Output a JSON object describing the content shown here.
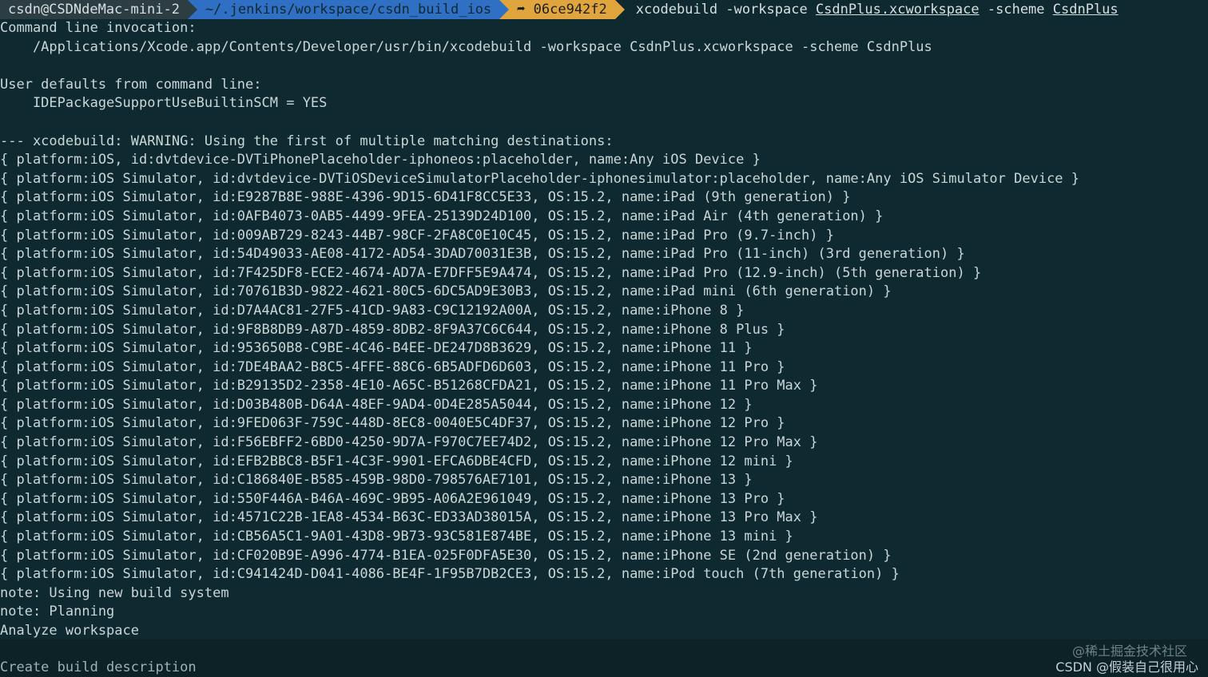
{
  "prompt": {
    "user_host": "csdn@CSDNdeMac-mini-2",
    "path": "~/.jenkins/workspace/csdn_build_ios",
    "git_branch": "➦ 06ce942f2",
    "cmd_prefix": "xcodebuild -workspace ",
    "cmd_workspace": "CsdnPlus.xcworkspace",
    "cmd_mid": " -scheme ",
    "cmd_scheme": "CsdnPlus"
  },
  "output_lines": [
    "Command line invocation:",
    "    /Applications/Xcode.app/Contents/Developer/usr/bin/xcodebuild -workspace CsdnPlus.xcworkspace -scheme CsdnPlus",
    "",
    "User defaults from command line:",
    "    IDEPackageSupportUseBuiltinSCM = YES",
    "",
    "--- xcodebuild: WARNING: Using the first of multiple matching destinations:",
    "{ platform:iOS, id:dvtdevice-DVTiPhonePlaceholder-iphoneos:placeholder, name:Any iOS Device }",
    "{ platform:iOS Simulator, id:dvtdevice-DVTiOSDeviceSimulatorPlaceholder-iphonesimulator:placeholder, name:Any iOS Simulator Device }",
    "{ platform:iOS Simulator, id:E9287B8E-988E-4396-9D15-6D41F8CC5E33, OS:15.2, name:iPad (9th generation) }",
    "{ platform:iOS Simulator, id:0AFB4073-0AB5-4499-9FEA-25139D24D100, OS:15.2, name:iPad Air (4th generation) }",
    "{ platform:iOS Simulator, id:009AB729-8243-44B7-98CF-2FA8C0E10C45, OS:15.2, name:iPad Pro (9.7-inch) }",
    "{ platform:iOS Simulator, id:54D49033-AE08-4172-AD54-3DAD70031E3B, OS:15.2, name:iPad Pro (11-inch) (3rd generation) }",
    "{ platform:iOS Simulator, id:7F425DF8-ECE2-4674-AD7A-E7DFF5E9A474, OS:15.2, name:iPad Pro (12.9-inch) (5th generation) }",
    "{ platform:iOS Simulator, id:70761B3D-9822-4621-80C5-6DC5AD9E30B3, OS:15.2, name:iPad mini (6th generation) }",
    "{ platform:iOS Simulator, id:D7A4AC81-27F5-41CD-9A83-C9C12192A00A, OS:15.2, name:iPhone 8 }",
    "{ platform:iOS Simulator, id:9F8B8DB9-A87D-4859-8DB2-8F9A37C6C644, OS:15.2, name:iPhone 8 Plus }",
    "{ platform:iOS Simulator, id:953650B8-C9BE-4C46-B4EE-DE247D8B3629, OS:15.2, name:iPhone 11 }",
    "{ platform:iOS Simulator, id:7DE4BAA2-B8C5-4FFE-88C6-6B5ADFD6D603, OS:15.2, name:iPhone 11 Pro }",
    "{ platform:iOS Simulator, id:B29135D2-2358-4E10-A65C-B51268CFDA21, OS:15.2, name:iPhone 11 Pro Max }",
    "{ platform:iOS Simulator, id:D03B480B-D64A-48EF-9AD4-0D4E285A5044, OS:15.2, name:iPhone 12 }",
    "{ platform:iOS Simulator, id:9FED063F-759C-448D-8EC8-0040E5C4DF37, OS:15.2, name:iPhone 12 Pro }",
    "{ platform:iOS Simulator, id:F56EBFF2-6BD0-4250-9D7A-F970C7EE74D2, OS:15.2, name:iPhone 12 Pro Max }",
    "{ platform:iOS Simulator, id:EFB2BBC8-B5F1-4C3F-9901-EFCA6DBE4CFD, OS:15.2, name:iPhone 12 mini }",
    "{ platform:iOS Simulator, id:C186840E-B585-459B-98D0-798576AE7101, OS:15.2, name:iPhone 13 }",
    "{ platform:iOS Simulator, id:550F446A-B46A-469C-9B95-A06A2E961049, OS:15.2, name:iPhone 13 Pro }",
    "{ platform:iOS Simulator, id:4571C22B-1EA8-4534-B63C-ED33AD38015A, OS:15.2, name:iPhone 13 Pro Max }",
    "{ platform:iOS Simulator, id:CB56A5C1-9A01-43D8-9B73-93C581E874BE, OS:15.2, name:iPhone 13 mini }",
    "{ platform:iOS Simulator, id:CF020B9E-A996-4774-B1EA-025F0DFA5E30, OS:15.2, name:iPhone SE (2nd generation) }",
    "{ platform:iOS Simulator, id:C941424D-D041-4086-BE4F-1F95B7DB2CE3, OS:15.2, name:iPod touch (7th generation) }",
    "note: Using new build system",
    "note: Planning",
    "Analyze workspace"
  ],
  "last_line": "Create build description",
  "watermark_top": "@稀土掘金技术社区",
  "watermark_bottom": "CSDN @假装自己很用心",
  "colors": {
    "background": "#0f2930",
    "path_segment": "#2f6fc4",
    "git_segment": "#e0a53c",
    "user_segment": "#2c3e44"
  }
}
